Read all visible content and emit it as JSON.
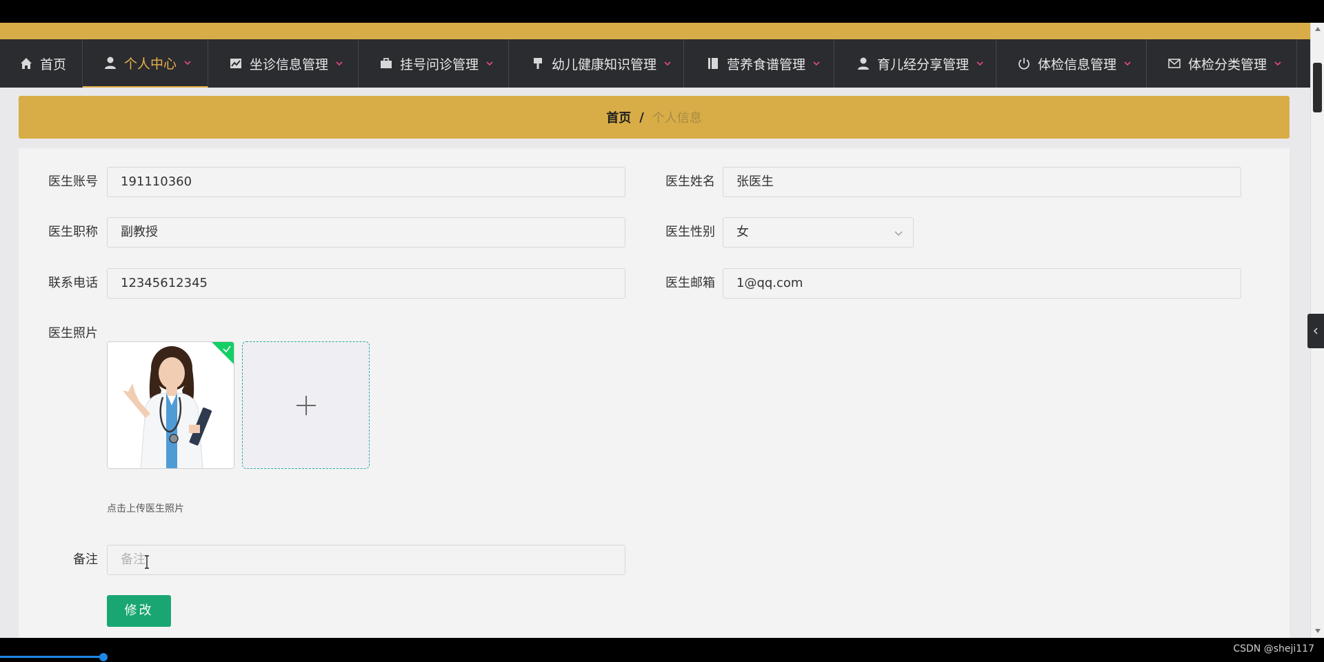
{
  "nav": {
    "items": [
      {
        "label": "首页",
        "icon": "home-icon"
      },
      {
        "label": "个人中心",
        "icon": "user-icon"
      },
      {
        "label": "坐诊信息管理",
        "icon": "chart-icon"
      },
      {
        "label": "挂号问诊管理",
        "icon": "briefcase-icon"
      },
      {
        "label": "幼儿健康知识管理",
        "icon": "brush-icon"
      },
      {
        "label": "营养食谱管理",
        "icon": "book-icon"
      },
      {
        "label": "育儿经分享管理",
        "icon": "user-icon"
      },
      {
        "label": "体检信息管理",
        "icon": "power-icon"
      },
      {
        "label": "体检分类管理",
        "icon": "mail-icon"
      }
    ],
    "active_label": "个人中心"
  },
  "breadcrumb": {
    "home": "首页",
    "separator": "/",
    "current": "个人信息"
  },
  "form": {
    "account_label": "医生账号",
    "account_value": "191110360",
    "name_label": "医生姓名",
    "name_value": "张医生",
    "title_label": "医生职称",
    "title_value": "副教授",
    "gender_label": "医生性别",
    "gender_value": "女",
    "phone_label": "联系电话",
    "phone_value": "12345612345",
    "email_label": "医生邮箱",
    "email_value": "1@qq.com",
    "photo_label": "医生照片",
    "photo_hint": "点击上传医生照片",
    "remark_label": "备注",
    "remark_placeholder": "备注",
    "submit_label": "修改"
  },
  "footer": {
    "watermark": "CSDN @sheji117"
  },
  "colors": {
    "gold": "#d8ad48",
    "nav_bg": "#2b2c30",
    "active": "#e7b14a",
    "button": "#1aa672",
    "success_badge": "#13ce66"
  }
}
